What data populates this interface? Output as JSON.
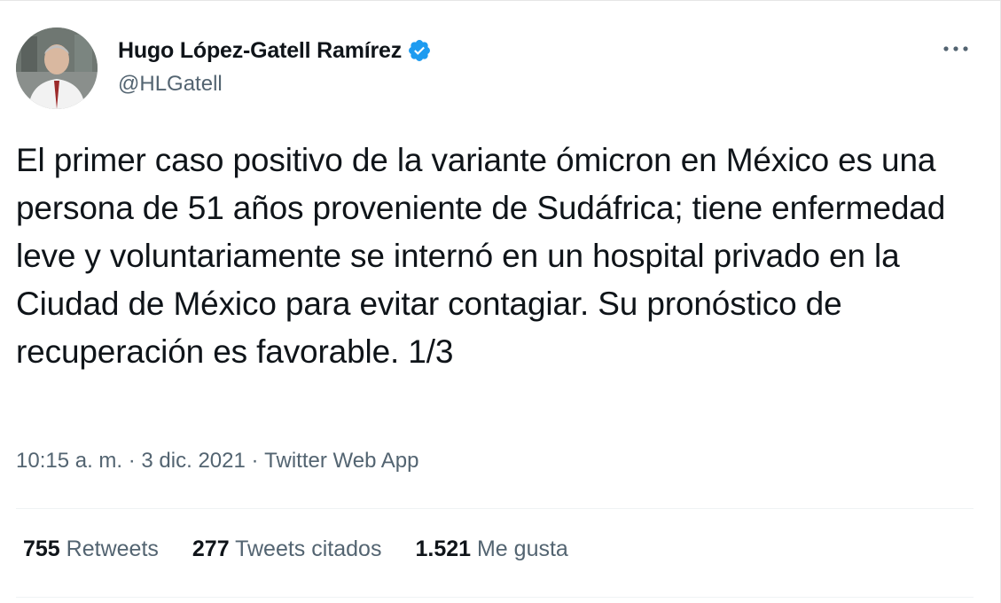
{
  "author": {
    "display_name": "Hugo López-Gatell Ramírez",
    "handle": "@HLGatell",
    "verified": true,
    "avatar_icon": "profile-photo-avatar"
  },
  "more_icon": "ellipsis-icon",
  "tweet": {
    "text": "El primer caso positivo de la variante ómicron en México es una persona de 51 años proveniente de Sudáfrica; tiene enfermedad leve y voluntariamente se internó en un hospital privado en la Ciudad de México para evitar contagiar. Su pronóstico de recuperación es favorable. 1/3"
  },
  "meta": {
    "time": "10:15 a. m.",
    "separator": " · ",
    "date": "3 dic. 2021",
    "source": "Twitter Web App"
  },
  "stats": {
    "retweets_count": "755",
    "retweets_label": "Retweets",
    "quotes_count": "277",
    "quotes_label": "Tweets citados",
    "likes_count": "1.521",
    "likes_label": "Me gusta"
  },
  "colors": {
    "verified": "#1d9bf0",
    "secondary_text": "#536471",
    "primary_text": "#0f1419"
  }
}
